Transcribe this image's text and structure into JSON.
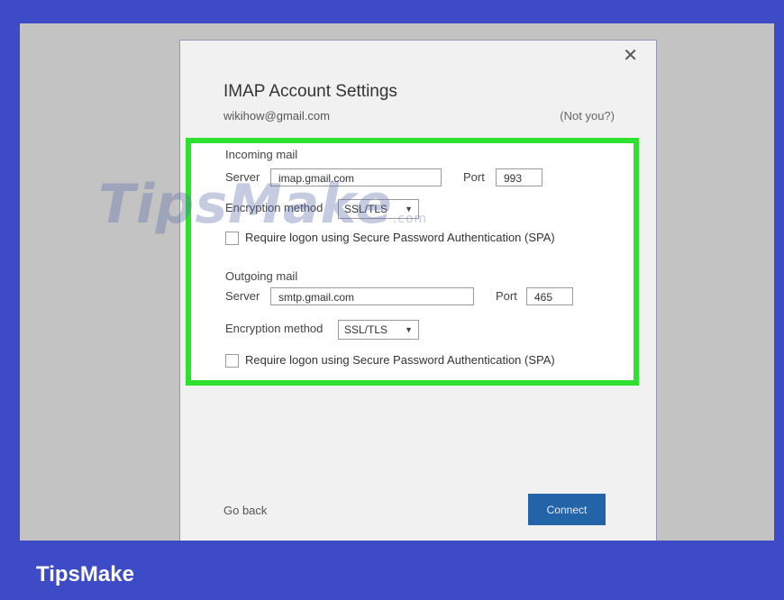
{
  "dialog": {
    "close_glyph": "✕",
    "title": "IMAP Account Settings",
    "email": "wikihow@gmail.com",
    "not_you": "(Not you?)",
    "incoming": {
      "heading": "Incoming mail",
      "server_label": "Server",
      "server_value": "imap.gmail.com",
      "port_label": "Port",
      "port_value": "993",
      "encryption_label": "Encryption method",
      "encryption_value": "SSL/TLS",
      "spa_label": "Require logon using Secure Password Authentication (SPA)"
    },
    "outgoing": {
      "heading": "Outgoing mail",
      "server_label": "Server",
      "server_value": "smtp.gmail.com",
      "port_label": "Port",
      "port_value": "465",
      "encryption_label": "Encryption method",
      "encryption_value": "SSL/TLS",
      "spa_label": "Require logon using Secure Password Authentication (SPA)"
    },
    "go_back": "Go back",
    "connect": "Connect"
  },
  "watermark": {
    "text": "TipsMake",
    "suffix": ".com"
  },
  "brand": "TipsMake",
  "colors": {
    "highlight": "#2fe12f",
    "connect": "#2363a8",
    "page_bg": "#3d4cc6"
  }
}
